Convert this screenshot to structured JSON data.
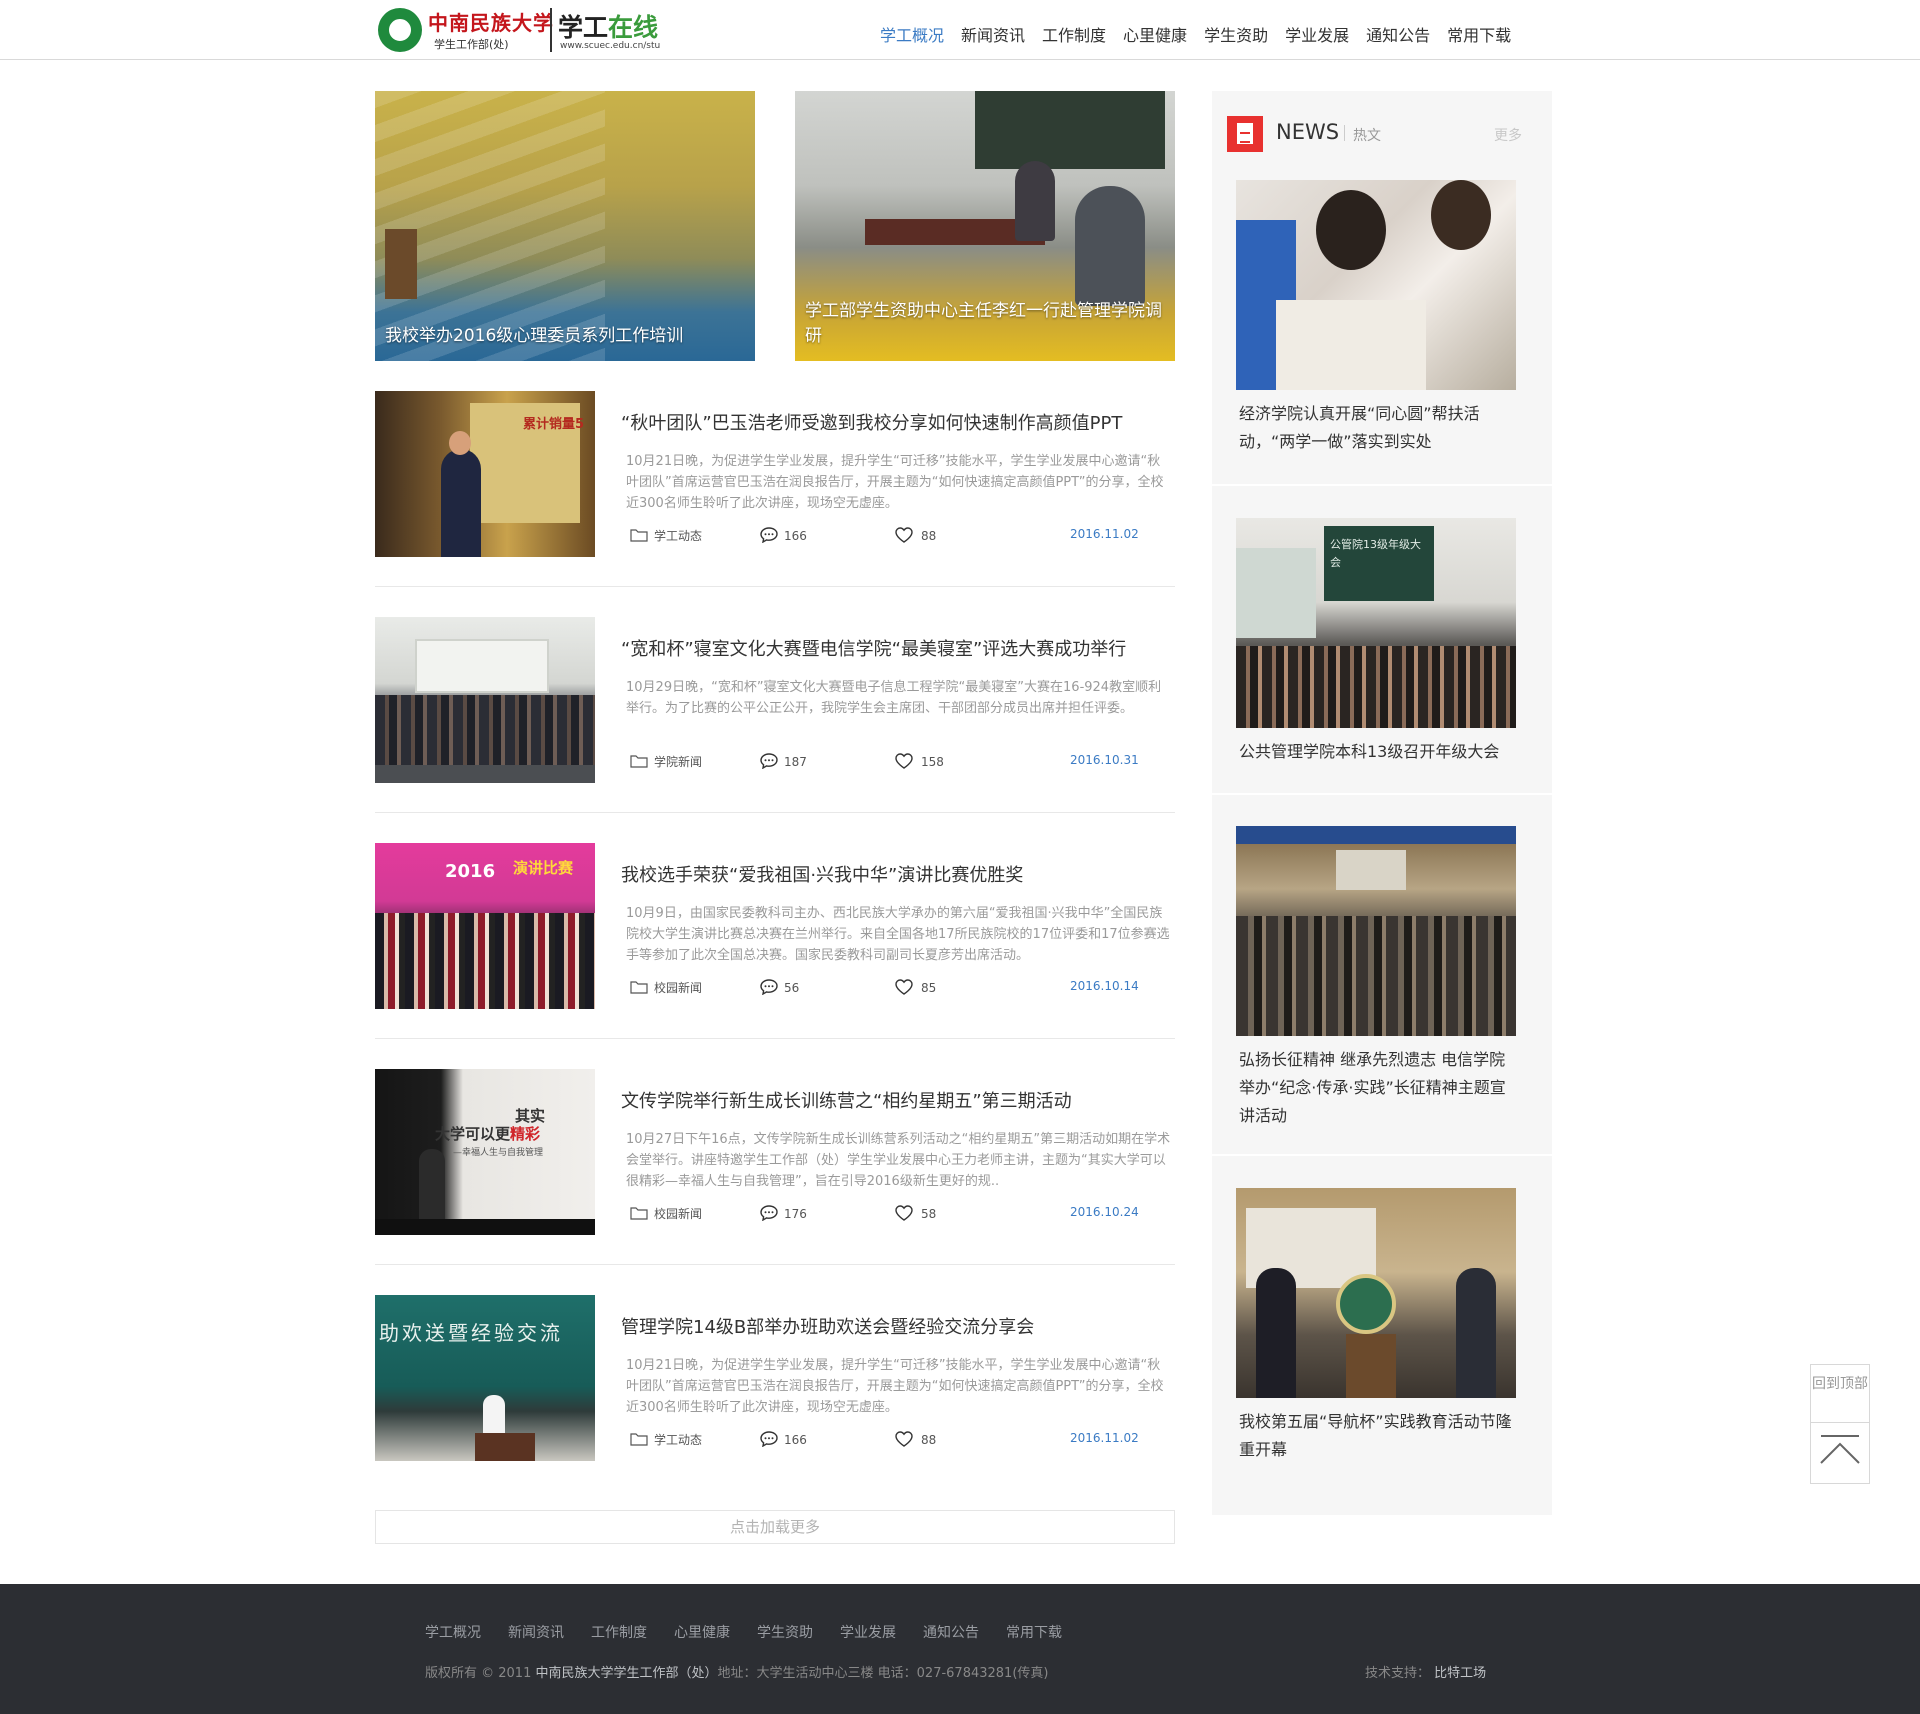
{
  "logo": {
    "school_name": "中南民族大学",
    "department": "学生工作部(处)",
    "site_name_part1": "学工",
    "site_name_part2": "在线",
    "url": "www.scuec.edu.cn/stu"
  },
  "nav": {
    "items": [
      "学工概况",
      "新闻资讯",
      "工作制度",
      "心里健康",
      "学生资助",
      "学业发展",
      "通知公告",
      "常用下载"
    ],
    "active_index": 0
  },
  "featured": [
    {
      "caption": "我校举办2016级心理委员系列工作培训"
    },
    {
      "caption": "学工部学生资助中心主任李红一行赴管理学院调研"
    }
  ],
  "articles": [
    {
      "title": "“秋叶团队”巴玉浩老师受邀到我校分享如何快速制作高颜值PPT",
      "summary": "10月21日晚，为促进学生学业发展，提升学生“可迁移”技能水平，学生学业发展中心邀请“秋叶团队”首席运营官巴玉浩在润良报告厅，开展主题为“如何快速搞定高颜值PPT”的分享，全校近300名师生聆听了此次讲座，现场空无虚座。",
      "category": "学工动态",
      "comments": "166",
      "likes": "88",
      "date": "2016.11.02"
    },
    {
      "title": "“宽和杯”寝室文化大赛暨电信学院“最美寝室”评选大赛成功举行",
      "summary": "10月29日晚，“宽和杯”寝室文化大赛暨电子信息工程学院“最美寝室”大赛在16-924教室顺利举行。为了比赛的公平公正公开，我院学生会主席团、干部团部分成员出席并担任评委。",
      "category": "学院新闻",
      "comments": "187",
      "likes": "158",
      "date": "2016.10.31"
    },
    {
      "title": "我校选手荣获“爱我祖国·兴我中华”演讲比赛优胜奖",
      "summary": "10月9日，由国家民委教科司主办、西北民族大学承办的第六届“爱我祖国·兴我中华”全国民族院校大学生演讲比赛总决赛在兰州举行。来自全国各地17所民族院校的17位评委和17位参赛选手等参加了此次全国总决赛。国家民委教科司副司长夏彦芳出席活动。",
      "category": "校园新闻",
      "comments": "56",
      "likes": "85",
      "date": "2016.10.14"
    },
    {
      "title": "文传学院举行新生成长训练营之“相约星期五”第三期活动",
      "summary": "10月27日下午16点，文传学院新生成长训练营系列活动之“相约星期五”第三期活动如期在学术会堂举行。讲座特邀学生工作部（处）学生学业发展中心王力老师主讲，主题为“其实大学可以很精彩—幸福人生与自我管理”，旨在引导2016级新生更好的规..",
      "category": "校园新闻",
      "comments": "176",
      "likes": "58",
      "date": "2016.10.24"
    },
    {
      "title": "管理学院14级B部举办班助欢送会暨经验交流分享会",
      "summary": "10月21日晚，为促进学生学业发展，提升学生“可迁移”技能水平，学生学业发展中心邀请“秋叶团队”首席运营官巴玉浩在润良报告厅，开展主题为“如何快速搞定高颜值PPT”的分享，全校近300名师生聆听了此次讲座，现场空无虚座。",
      "category": "学工动态",
      "comments": "166",
      "likes": "88",
      "date": "2016.11.02"
    }
  ],
  "thumb_text": {
    "a1": "累计销量5",
    "a3_year": "2016",
    "a3_banner": "演讲比赛",
    "a4_line1": "其实",
    "a4_line2a": "大学可以更",
    "a4_line2b": "精彩",
    "a4_line3": "—幸福人生与自我管理",
    "a5_board": "助欢送暨经验交流",
    "s2_board": "公管院13级年级大会"
  },
  "load_more": "点击加载更多",
  "sidebar": {
    "title": "NEWS",
    "hot": "热文",
    "more": "更多",
    "items": [
      {
        "text": "经济学院认真开展“同心圆”帮扶活动，“两学一做”落实到实处"
      },
      {
        "text": "公共管理学院本科13级召开年级大会"
      },
      {
        "text": "弘扬长征精神 继承先烈遗志 电信学院举办“纪念·传承·实践”长征精神主题宣讲活动"
      },
      {
        "text": "我校第五届“导航杯”实践教育活动节隆重开幕"
      }
    ]
  },
  "back_to_top": "回到顶部",
  "footer": {
    "nav": [
      "学工概况",
      "新闻资讯",
      "工作制度",
      "心里健康",
      "学生资助",
      "学业发展",
      "通知公告",
      "常用下载"
    ],
    "copyright_prefix": "版权所有 © 2011",
    "copyright_org": "中南民族大学学生工作部（处）",
    "address": "地址：大学生活动中心三楼  电话：027-67843281(传真)",
    "support_label": "技术支持：",
    "support_org": "比特工场"
  },
  "colors": {
    "accent": "#3b7bc4",
    "brand_red": "#c4161c",
    "news_icon": "#e8312f",
    "footer_bg": "#2c2e33"
  }
}
